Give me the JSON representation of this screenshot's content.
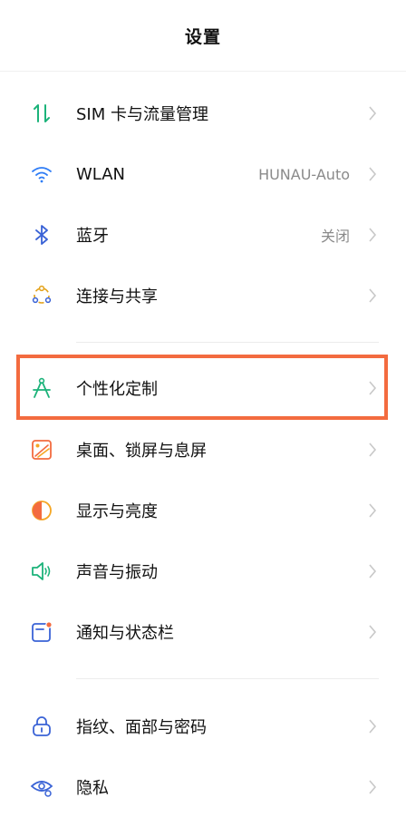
{
  "header": {
    "title": "设置"
  },
  "colors": {
    "accent_green": "#1cb37a",
    "wifi_blue": "#2f7df6",
    "bluetooth_blue": "#3a63d6",
    "highlight_orange": "#f36b3f",
    "chevron_gray": "#c8c8c8"
  },
  "items": [
    {
      "label": "SIM 卡与流量管理",
      "value": "",
      "icon": "sim-data-icon"
    },
    {
      "label": "WLAN",
      "value": "HUNAU-Auto",
      "icon": "wifi-icon"
    },
    {
      "label": "蓝牙",
      "value": "关闭",
      "icon": "bluetooth-icon"
    },
    {
      "label": "连接与共享",
      "value": "",
      "icon": "share-icon"
    },
    {
      "label": "个性化定制",
      "value": "",
      "icon": "compass-icon"
    },
    {
      "label": "桌面、锁屏与息屏",
      "value": "",
      "icon": "wallpaper-icon"
    },
    {
      "label": "显示与亮度",
      "value": "",
      "icon": "brightness-icon"
    },
    {
      "label": "声音与振动",
      "value": "",
      "icon": "speaker-icon"
    },
    {
      "label": "通知与状态栏",
      "value": "",
      "icon": "notification-icon"
    },
    {
      "label": "指纹、面部与密码",
      "value": "",
      "icon": "lock-icon"
    },
    {
      "label": "隐私",
      "value": "",
      "icon": "privacy-eye-icon"
    }
  ]
}
